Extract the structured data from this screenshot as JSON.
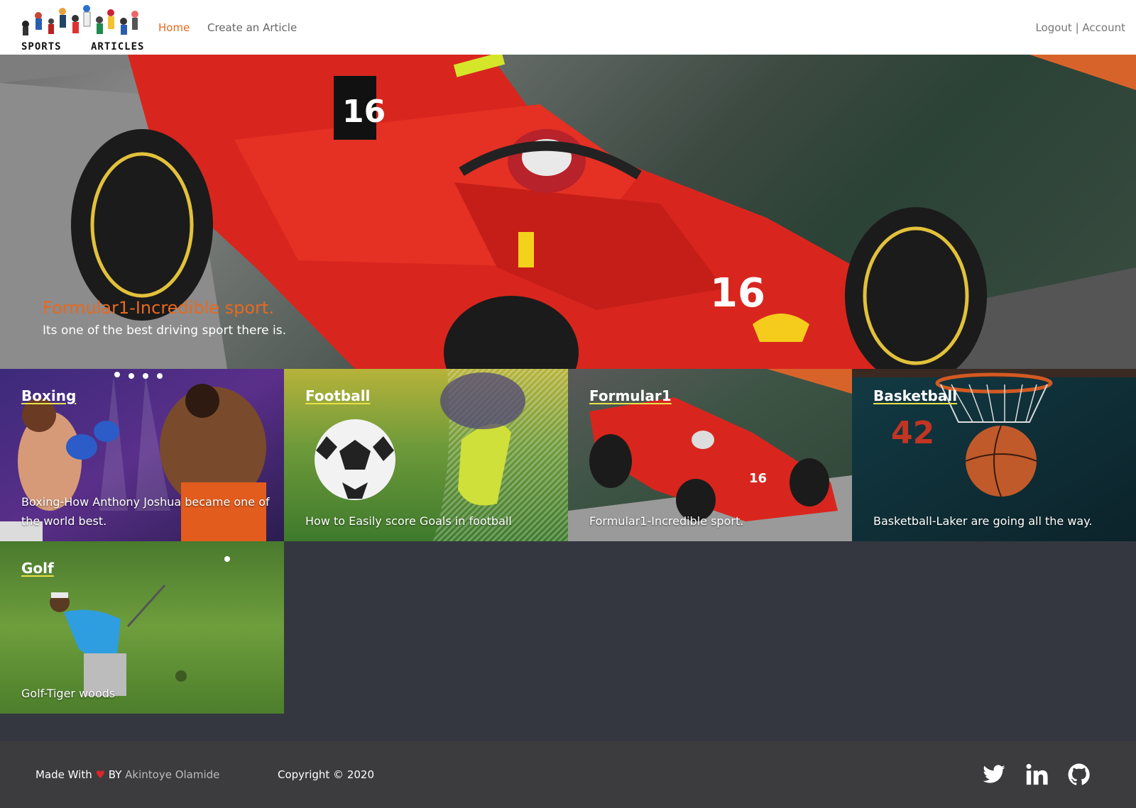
{
  "nav": {
    "logo_left": "SPORTS",
    "logo_right": "ARTICLES",
    "home": "Home",
    "create": "Create an Article",
    "logout": "Logout",
    "separator": "|",
    "account": "Account",
    "active_color": "#e8691e"
  },
  "hero": {
    "title": "Formular1-Incredible sport.",
    "subtitle": "Its one of the best driving sport there is."
  },
  "categories": [
    {
      "title": "Boxing",
      "desc": "Boxing-How Anthony Joshua became one of the world best."
    },
    {
      "title": "Football",
      "desc": "How to Easily score Goals in football"
    },
    {
      "title": "Formular1",
      "desc": "Formular1-Incredible sport."
    },
    {
      "title": "Basketball",
      "desc": "Basketball-Laker are going all the way."
    },
    {
      "title": "Golf",
      "desc": "Golf-Tiger woods"
    }
  ],
  "footer": {
    "made_with": "Made With",
    "heart": "♥",
    "by": "BY",
    "author": "Akintoye Olamide",
    "copyright": "Copyright © 2020",
    "social": [
      "twitter-icon",
      "linkedin-icon",
      "github-icon"
    ]
  }
}
